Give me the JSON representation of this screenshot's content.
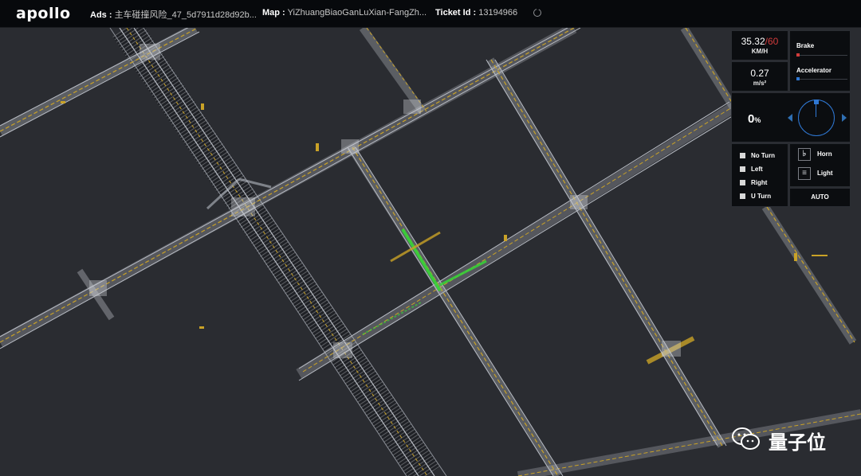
{
  "header": {
    "logo": "apollo",
    "ads_label": "Ads :",
    "ads_value": "主车碰撞风险_47_5d7911d28d92b...",
    "map_label": "Map :",
    "map_value": "YiZhuangBiaoGanLuXian-FangZh...",
    "ticket_label": "Ticket Id :",
    "ticket_value": "13194966"
  },
  "dashboard": {
    "speed": "35.32",
    "speed_sep": "/",
    "speed_limit": "60",
    "speed_unit": "KM/H",
    "acceleration": "0.27",
    "acceleration_unit": "m/s²",
    "brake_label": "Brake",
    "brake_level": 0.0,
    "accelerator_label": "Accelerator",
    "accelerator_level": 0.0,
    "steering_percent": "0",
    "steering_unit": "%",
    "signals": [
      "No Turn",
      "Left",
      "Right",
      "U Turn"
    ],
    "horn_label": "Horn",
    "light_label": "Light",
    "mode": "AUTO"
  },
  "colors": {
    "brake": "#d23b3b",
    "accelerator": "#2f78d4",
    "route": "#36d636",
    "lane_yellow": "#c9a227",
    "road_gray": "#b8bcc4"
  },
  "watermark": "量子位"
}
